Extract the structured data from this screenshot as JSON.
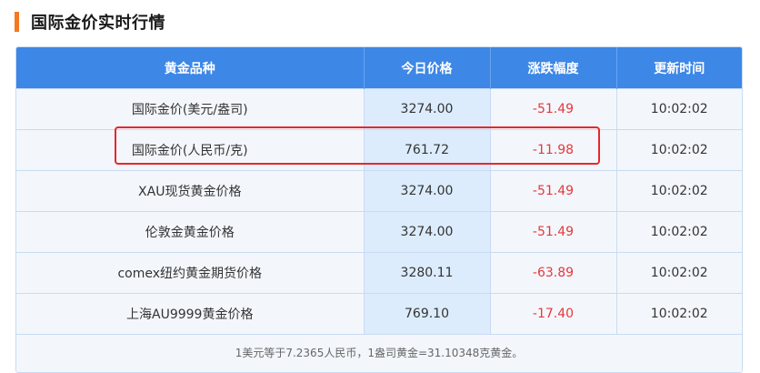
{
  "section": {
    "title": "国际金价实时行情"
  },
  "table": {
    "headers": [
      "黄金品种",
      "今日价格",
      "涨跌幅度",
      "更新时间"
    ],
    "rows": [
      {
        "name": "国际金价(美元/盎司)",
        "price": "3274.00",
        "change": "-51.49",
        "time": "10:02:02"
      },
      {
        "name": "国际金价(人民币/克)",
        "price": "761.72",
        "change": "-11.98",
        "time": "10:02:02"
      },
      {
        "name": "XAU现货黄金价格",
        "price": "3274.00",
        "change": "-51.49",
        "time": "10:02:02"
      },
      {
        "name": "伦敦金黄金价格",
        "price": "3274.00",
        "change": "-51.49",
        "time": "10:02:02"
      },
      {
        "name": "comex纽约黄金期货价格",
        "price": "3280.11",
        "change": "-63.89",
        "time": "10:02:02"
      },
      {
        "name": "上海AU9999黄金价格",
        "price": "769.10",
        "change": "-17.40",
        "time": "10:02:02"
      }
    ],
    "footnote": "1美元等于7.2365人民币，1盎司黄金=31.10348克黄金。"
  },
  "colors": {
    "accent": "#f47920",
    "header_bg": "#3d87e6",
    "negative": "#e5393b",
    "highlight": "#e8272a"
  }
}
